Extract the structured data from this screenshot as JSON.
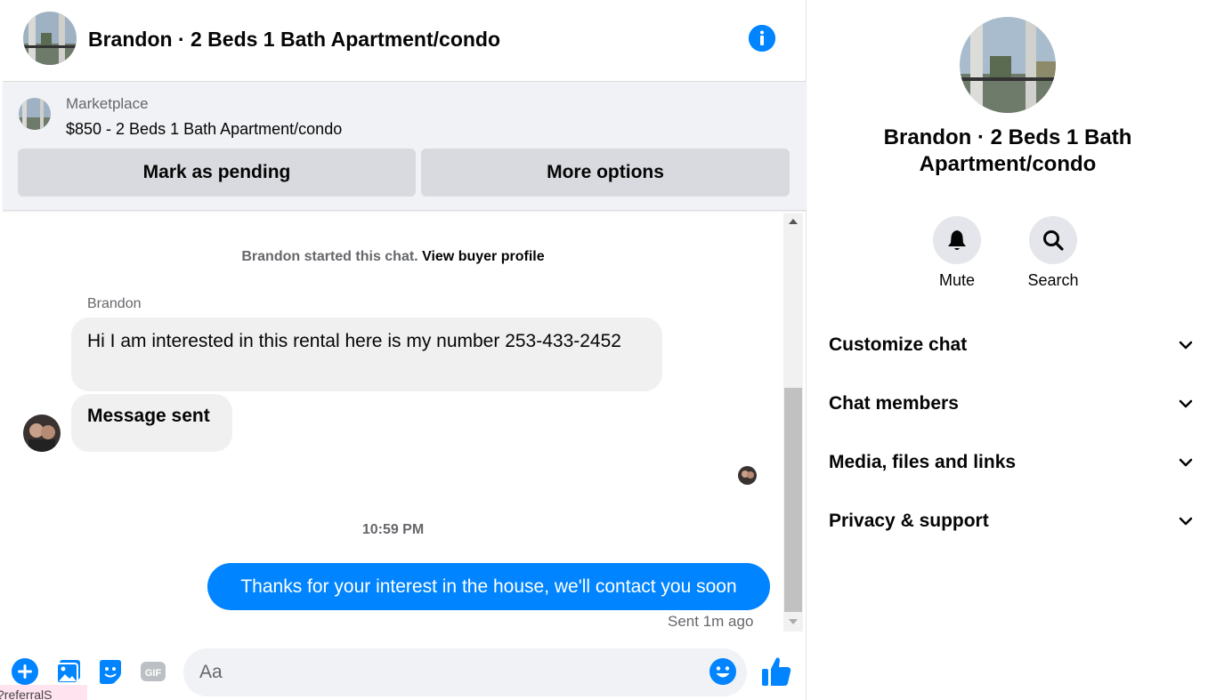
{
  "header": {
    "title": "Brandon · 2 Beds 1 Bath Apartment/condo",
    "info_icon": "info-icon"
  },
  "marketplace": {
    "label": "Marketplace",
    "listing": "$850 - 2 Beds 1 Bath Apartment/condo",
    "mark_pending_label": "Mark as pending",
    "more_options_label": "More options"
  },
  "conversation": {
    "started_text": "Brandon started this chat.",
    "view_profile_label": "View buyer profile",
    "sender_name": "Brandon",
    "incoming_message_1": "Hi I am interested in this rental here  is my number 253-433-2452",
    "incoming_message_2": "Message sent",
    "timestamp": "10:59 PM",
    "outgoing_message": "Thanks for your interest in the house, we'll contact you soon",
    "sent_status": "Sent 1m ago"
  },
  "composer": {
    "placeholder": "Aa",
    "icons": [
      "plus-icon",
      "image-icon",
      "sticker-icon",
      "gif-icon",
      "emoji-icon",
      "thumbs-up-icon"
    ],
    "gif_label": "GIF"
  },
  "tooltip_text": "?referralS",
  "info_panel": {
    "title": "Brandon · 2 Beds 1 Bath Apartment/condo",
    "mute_label": "Mute",
    "search_label": "Search",
    "sections": [
      {
        "label": "Customize chat"
      },
      {
        "label": "Chat members"
      },
      {
        "label": "Media, files and links"
      },
      {
        "label": "Privacy & support"
      }
    ]
  },
  "colors": {
    "accent": "#0084ff",
    "bubble_in": "#f0f0f0",
    "button_grey": "#d8dadf"
  }
}
